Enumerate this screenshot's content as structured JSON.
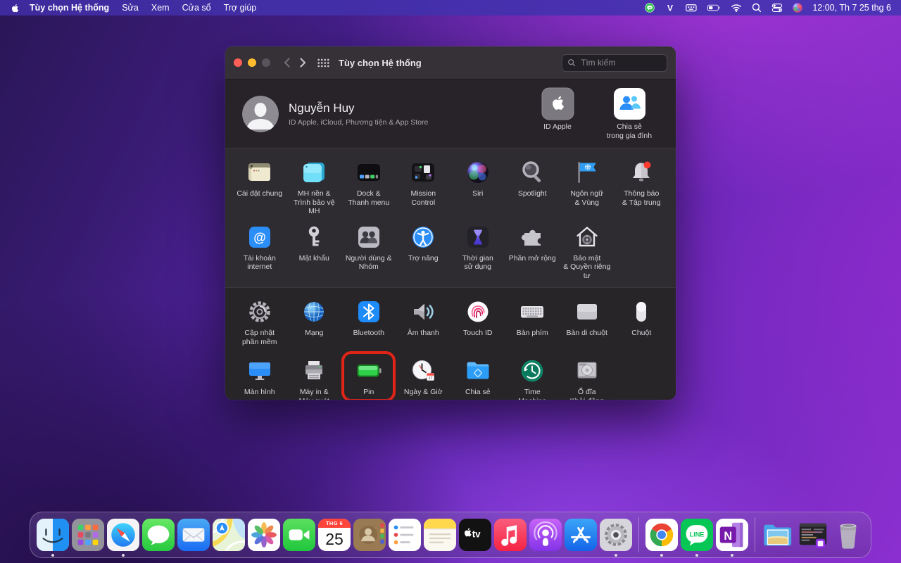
{
  "colors": {
    "highlight_red": "#e02417",
    "menubar_purple": "#42309f",
    "window_bg": "#28252a"
  },
  "menubar": {
    "menus": [
      {
        "id": "system-preferences",
        "label": "Tùy chọn Hệ thống",
        "bold": true
      },
      {
        "id": "edit",
        "label": "Sửa"
      },
      {
        "id": "view",
        "label": "Xem"
      },
      {
        "id": "window",
        "label": "Cửa sổ"
      },
      {
        "id": "help",
        "label": "Trợ giúp"
      }
    ],
    "status_icons": [
      {
        "name": "line-app"
      },
      {
        "name": "v-input",
        "text": "V"
      },
      {
        "name": "input-source"
      },
      {
        "name": "battery-status"
      },
      {
        "name": "wifi"
      },
      {
        "name": "spotlight-search"
      },
      {
        "name": "control-center"
      },
      {
        "name": "siri-status"
      }
    ],
    "clock": "12:00, Th 7 25 thg 6"
  },
  "window": {
    "title": "Tùy chọn Hệ thống",
    "search_placeholder": "Tìm kiếm",
    "account": {
      "name": "Nguyễn Huy",
      "subtitle": "ID Apple, iCloud, Phương tiện & App Store",
      "actions": [
        {
          "id": "apple-id",
          "label": "ID Apple"
        },
        {
          "id": "family-sharing",
          "label": "Chia sẻ\ntrong gia đình"
        }
      ]
    },
    "groups": [
      {
        "rows": [
          [
            {
              "id": "general",
              "label": "Cài đặt chung"
            },
            {
              "id": "desktop",
              "label": "MH nền &\nTrình bảo vệ MH"
            },
            {
              "id": "dock",
              "label": "Dock &\nThanh menu"
            },
            {
              "id": "mission-control",
              "label": "Mission\nControl"
            },
            {
              "id": "siri",
              "label": "Siri"
            },
            {
              "id": "spotlight",
              "label": "Spotlight"
            },
            {
              "id": "language",
              "label": "Ngôn ngữ\n& Vùng"
            },
            {
              "id": "notifications",
              "label": "Thông báo\n& Tập trung"
            }
          ],
          [
            {
              "id": "internet-accounts",
              "label": "Tài khoản\ninternet"
            },
            {
              "id": "passwords",
              "label": "Mật khẩu"
            },
            {
              "id": "users",
              "label": "Người dùng &\nNhóm"
            },
            {
              "id": "accessibility",
              "label": "Trợ năng"
            },
            {
              "id": "screen-time",
              "label": "Thời gian\nsử dụng"
            },
            {
              "id": "extensions",
              "label": "Phần mở rộng"
            },
            {
              "id": "security",
              "label": "Bảo mật\n& Quyền riêng tư"
            }
          ]
        ]
      },
      {
        "rows": [
          [
            {
              "id": "software-update",
              "label": "Cập nhật\nphần mềm"
            },
            {
              "id": "network",
              "label": "Mạng"
            },
            {
              "id": "bluetooth",
              "label": "Bluetooth"
            },
            {
              "id": "sound",
              "label": "Âm thanh"
            },
            {
              "id": "touch-id",
              "label": "Touch ID"
            },
            {
              "id": "keyboard",
              "label": "Bàn phím"
            },
            {
              "id": "trackpad",
              "label": "Bàn di chuột"
            },
            {
              "id": "mouse",
              "label": "Chuột"
            }
          ],
          [
            {
              "id": "displays",
              "label": "Màn hình"
            },
            {
              "id": "printers",
              "label": "Máy in &\nMáy quét"
            },
            {
              "id": "battery",
              "label": "Pin",
              "highlighted": true
            },
            {
              "id": "datetime",
              "label": "Ngày & Giờ",
              "badge": "17"
            },
            {
              "id": "sharing",
              "label": "Chia sẻ"
            },
            {
              "id": "time-machine",
              "label": "Time\nMachine"
            },
            {
              "id": "startup-disk",
              "label": "Ổ đĩa\nKhởi động"
            }
          ]
        ]
      }
    ]
  },
  "dock": {
    "items": [
      {
        "name": "finder",
        "running": true
      },
      {
        "name": "launchpad"
      },
      {
        "name": "safari",
        "running": true
      },
      {
        "name": "messages"
      },
      {
        "name": "mail"
      },
      {
        "name": "maps"
      },
      {
        "name": "photos"
      },
      {
        "name": "facetime"
      },
      {
        "name": "calendar",
        "month": "THG 6",
        "day": "25"
      },
      {
        "name": "contacts"
      },
      {
        "name": "reminders"
      },
      {
        "name": "notes"
      },
      {
        "name": "tv",
        "text": "tv"
      },
      {
        "name": "music"
      },
      {
        "name": "podcasts"
      },
      {
        "name": "app-store"
      },
      {
        "name": "system-preferences",
        "running": true
      },
      {
        "name": "separator"
      },
      {
        "name": "chrome",
        "running": true
      },
      {
        "name": "line",
        "running": true,
        "text": "LINE"
      },
      {
        "name": "onenote",
        "running": true,
        "text": "N"
      },
      {
        "name": "separator"
      },
      {
        "name": "pictures-folder"
      },
      {
        "name": "window-thumbnail"
      },
      {
        "name": "trash"
      }
    ]
  }
}
